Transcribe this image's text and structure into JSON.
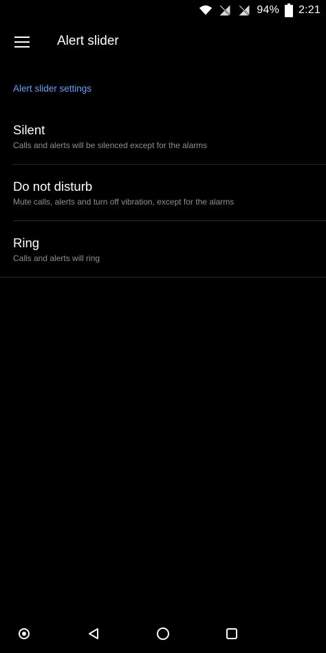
{
  "status_bar": {
    "battery": "94%",
    "time": "2:21",
    "icons": [
      "wifi-icon",
      "no-sim-icon",
      "no-signal-icon",
      "battery-icon"
    ]
  },
  "app_bar": {
    "title": "Alert slider",
    "menu_icon": "hamburger-menu-icon"
  },
  "section": {
    "header": "Alert slider settings"
  },
  "options": [
    {
      "title": "Silent",
      "summary": "Calls and alerts will be silenced except for the alarms"
    },
    {
      "title": "Do not disturb",
      "summary": "Mute calls, alerts and turn off vibration, except for the alarms"
    },
    {
      "title": "Ring",
      "summary": "Calls and alerts will ring"
    }
  ],
  "nav_bar": {
    "icons": [
      "assistant-icon",
      "back-icon",
      "home-icon",
      "recents-icon"
    ]
  },
  "colors": {
    "background": "#000000",
    "accent": "#6f9ff0",
    "summary_text": "#8f8f8f",
    "divider": "#2a2a2a"
  }
}
